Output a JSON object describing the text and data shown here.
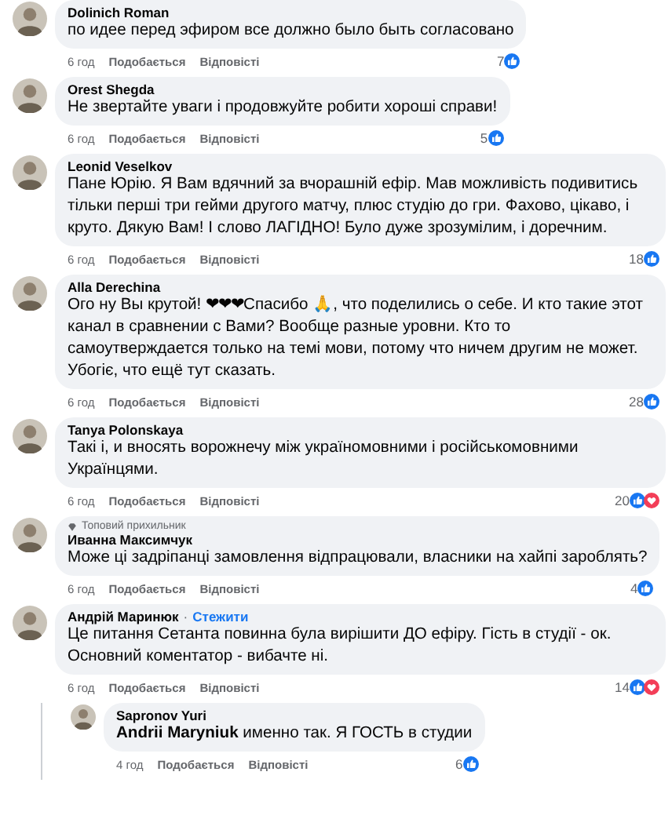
{
  "comments": [
    {
      "author": "Dolinich Roman",
      "text": "по идее перед эфиром все должно было быть согласовано",
      "time": "6 год",
      "like": "Подобається",
      "reply": "Відповісті",
      "reaction_count": "7",
      "reactions": [
        {
          "kind": "like"
        }
      ]
    },
    {
      "author": "Orest Shegda",
      "text": "Не звертайте уваги і продовжуйте робити хороші справи!",
      "time": "6 год",
      "like": "Подобається",
      "reply": "Відповісті",
      "reaction_count": "5",
      "reactions": [
        {
          "kind": "like"
        }
      ]
    },
    {
      "author": "Leonid Veselkov",
      "text": "Пане Юрію. Я Вам вдячний за вчорашній ефір. Мав можливість подивитись тільки перші три гейми другого матчу, плюс студію до гри. Фахово, цікаво, і круто. Дякую Вам! І слово ЛАГІДНО! Було дуже зрозумілим, і доречним.",
      "time": "6 год",
      "like": "Подобається",
      "reply": "Відповісті",
      "reaction_count": "18",
      "reactions": [
        {
          "kind": "like"
        }
      ]
    },
    {
      "author": "Alla Derechina",
      "text": "Ого ну Вы крутой! ❤❤❤Спасибо 🙏, что поделились о себе. И кто такие этот канал в сравнении с Вами? Вообще разные уровни. Кто то самоутверждается только на темі мови, потому что ничем другим не может. Убогіє, что ещё тут сказать.",
      "time": "6 год",
      "like": "Подобається",
      "reply": "Відповісті",
      "reaction_count": "28",
      "reactions": [
        {
          "kind": "like"
        }
      ]
    },
    {
      "author": "Tanya Polonskaya",
      "text": "Такі і,     и вносять ворожнечу між україномовними і російськомовними Українцями.",
      "time": "6 год",
      "like": "Подобається",
      "reply": "Відповісті",
      "reaction_count": "20",
      "reactions": [
        {
          "kind": "like"
        },
        {
          "kind": "love"
        }
      ]
    },
    {
      "author": "Иванна Максимчук",
      "badge": "Топовий прихильник",
      "text": "Може ці задріпанці замовлення відпрацювали, власники на хайпі зароблять?",
      "time": "6 год",
      "like": "Подобається",
      "reply": "Відповісті",
      "reaction_count": "4",
      "reactions": [
        {
          "kind": "like"
        }
      ]
    },
    {
      "author": "Андрій Маринюк",
      "follow_separator": "·",
      "follow": "Стежити",
      "text": "Це питання Сетанта повинна була вирішити ДО ефіру. Гість в студії - ок. Основний коментатор - вибачте ні.",
      "time": "6 год",
      "like": "Подобається",
      "reply": "Відповісті",
      "reaction_count": "14",
      "reactions": [
        {
          "kind": "like"
        },
        {
          "kind": "love"
        }
      ],
      "children": [
        {
          "author": "Sapronov Yuri",
          "text": "**Andrii Maryniuk** именно так. Я ГОСТЬ в студии",
          "time": "4 год",
          "like": "Подобається",
          "reply": "Відповісті",
          "reaction_count": "6",
          "reactions": [
            {
              "kind": "like"
            }
          ]
        }
      ]
    }
  ]
}
